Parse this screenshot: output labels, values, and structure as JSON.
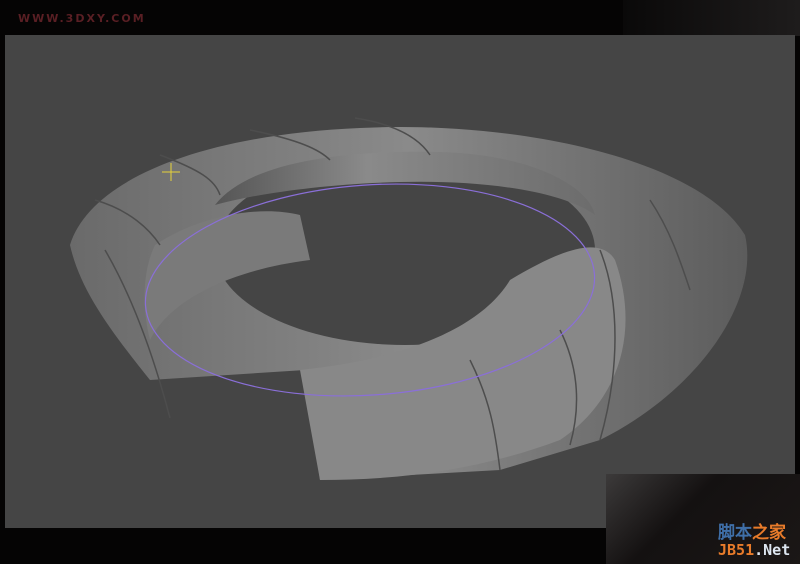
{
  "watermark_top": "WWW.3DXY.COM",
  "watermark_bottom": {
    "line1_a": "脚本",
    "line1_b": "之家",
    "line2_a": "JB51",
    "line2_b": ".Net"
  },
  "colors": {
    "viewport_bg": "#454545",
    "spline": "#8a6fd8",
    "cursor": "#e6d23a"
  }
}
